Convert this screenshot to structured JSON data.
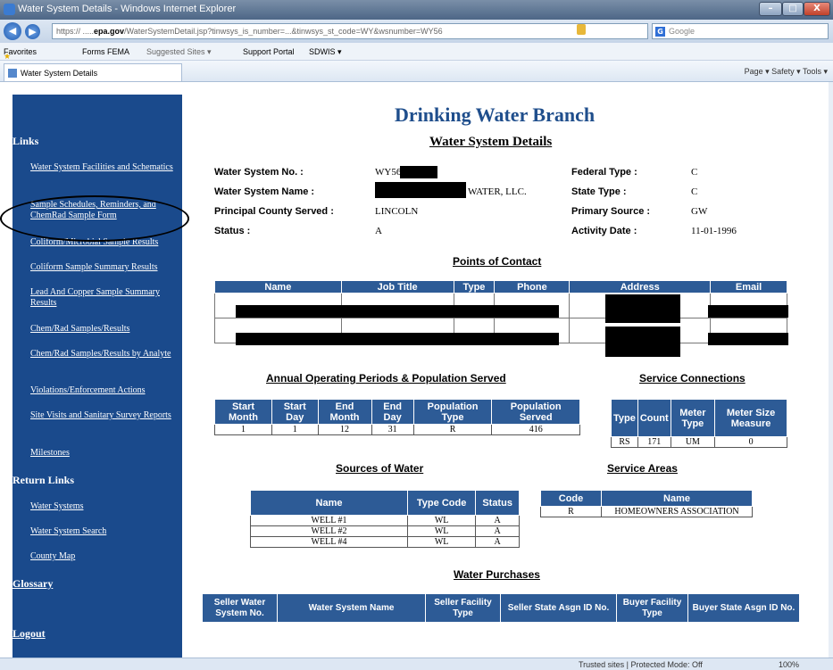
{
  "browser": {
    "title": "Water System Details - Windows Internet Explorer",
    "url_host": "https://",
    "url_domain": "epa.gov",
    "url_rest": "/WaterSystemDetail.jsp?tinwsys_is_number=...&tinwsys_st_code=WY&wsnumber=WY56",
    "search_text": "Google",
    "tab_title": "Water System Details",
    "status_text": "Trusted sites | Protected Mode: Off",
    "zoom": "100%",
    "minimize": "–",
    "maximize": "□",
    "close": "X",
    "back": "◀",
    "forward": "▶",
    "command_bar": "Page ▾   Safety ▾   Tools ▾"
  },
  "favorites": {
    "favorites": "Favorites",
    "items": [
      "Forms FEMA",
      "Suggested Sites ▾",
      "Support Portal",
      "SDWIS ▾"
    ]
  },
  "sidebar": {
    "links_heading": "Links",
    "links": [
      "Water System Facilities and Schematics",
      "Sample Schedules, Reminders, and ChemRad Sample Form",
      "Coliform/Microbial Sample Results",
      "Coliform Sample Summary Results",
      "Lead And Copper Sample Summary Results",
      "Chem/Rad Samples/Results",
      "Chem/Rad Samples/Results by Analyte",
      "Violations/Enforcement Actions",
      "Site Visits and Sanitary Survey Reports",
      "Milestones"
    ],
    "return_heading": "Return Links",
    "return_links": [
      "Water Systems",
      "Water System Search",
      "County Map"
    ],
    "glossary": "Glossary",
    "logout": "Logout"
  },
  "header": {
    "title": "Drinking Water Branch",
    "subtitle": "Water System Details"
  },
  "details": {
    "ws_no_label": "Water System No. :",
    "ws_no": "WY56",
    "ws_name_label": "Water System Name :",
    "ws_name": "WATER, LLC.",
    "county_label": "Principal County Served :",
    "county": "LINCOLN",
    "status_label": "Status :",
    "status": "A",
    "fed_type_label": "Federal Type :",
    "fed_type": "C",
    "state_type_label": "State Type :",
    "state_type": "C",
    "primary_source_label": "Primary Source :",
    "primary_source": "GW",
    "activity_label": "Activity Date :",
    "activity_date": "11-01-1996"
  },
  "poc": {
    "heading": "Points of Contact",
    "columns": [
      "Name",
      "Job Title",
      "Type",
      "Phone",
      "Address",
      "Email"
    ]
  },
  "operating": {
    "heading": "Annual Operating Periods & Population Served",
    "columns": [
      "Start Month",
      "Start Day",
      "End Month",
      "End Day",
      "Population Type",
      "Population Served"
    ],
    "rows": [
      [
        "1",
        "1",
        "12",
        "31",
        "R",
        "416"
      ]
    ]
  },
  "connections": {
    "heading": "Service Connections",
    "columns": [
      "Type",
      "Count",
      "Meter Type",
      "Meter Size Measure"
    ],
    "rows": [
      [
        "RS",
        "171",
        "UM",
        "0"
      ]
    ]
  },
  "sources": {
    "heading": "Sources of Water",
    "columns": [
      "Name",
      "Type Code",
      "Status"
    ],
    "rows": [
      [
        "WELL #1",
        "WL",
        "A"
      ],
      [
        "WELL #2",
        "WL",
        "A"
      ],
      [
        "WELL #4",
        "WL",
        "A"
      ]
    ]
  },
  "areas": {
    "heading": "Service Areas",
    "columns": [
      "Code",
      "Name"
    ],
    "rows": [
      [
        "R",
        "HOMEOWNERS ASSOCIATION"
      ]
    ]
  },
  "purchases": {
    "heading": "Water Purchases",
    "columns": [
      "Seller Water System No.",
      "Water System Name",
      "Seller Facility Type",
      "Seller State Asgn ID No.",
      "Buyer Facility Type",
      "Buyer State Asgn ID No."
    ]
  }
}
